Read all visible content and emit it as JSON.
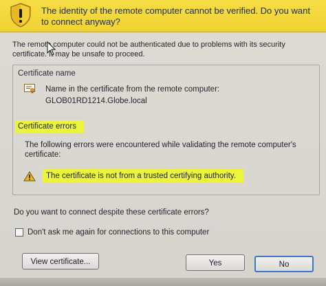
{
  "banner": {
    "title": "The identity of the remote computer cannot be verified. Do you want to connect anyway?",
    "warning_icon": "warning-shield-icon"
  },
  "intro_text": "The remote computer could not be authenticated due to problems with its security certificate. It may be unsafe to proceed.",
  "certificate_name": {
    "label": "Certificate name",
    "line1": "Name in the certificate from the remote computer:",
    "line2": "GLOB01RD1214.Globe.local",
    "icon": "certificate-icon"
  },
  "certificate_errors": {
    "label": "Certificate errors",
    "description": "The following errors were encountered while validating the remote computer's certificate:",
    "items": [
      {
        "text": "The certificate is not from a trusted certifying authority.",
        "icon": "warning-triangle-icon"
      }
    ]
  },
  "question": "Do you want to connect despite these certificate errors?",
  "checkbox": {
    "label": "Don't ask me again for connections to this computer",
    "checked": false
  },
  "buttons": {
    "view_certificate": "View certificate...",
    "yes": "Yes",
    "no": "No"
  },
  "colors": {
    "banner": "#f4d83c",
    "highlight": "#ecf53a",
    "focus_border": "#3b78c6"
  }
}
